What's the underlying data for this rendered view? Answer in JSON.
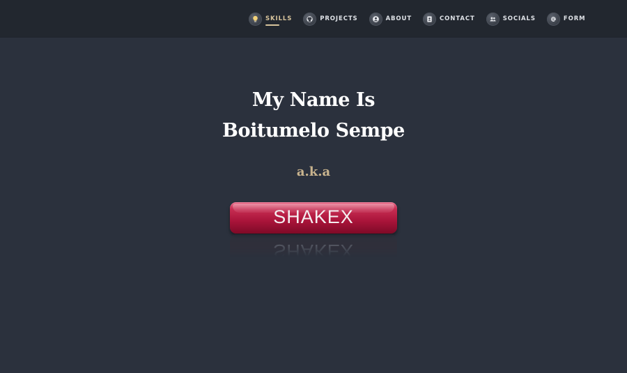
{
  "nav": {
    "items": [
      {
        "label": "SKILLS",
        "icon": "lightbulb-icon",
        "active": true
      },
      {
        "label": "PROJECTS",
        "icon": "github-icon",
        "active": false
      },
      {
        "label": "ABOUT",
        "icon": "user-circle-icon",
        "active": false
      },
      {
        "label": "CONTACT",
        "icon": "address-book-icon",
        "active": false
      },
      {
        "label": "SOCIALS",
        "icon": "users-icon",
        "active": false
      },
      {
        "label": "FORM",
        "icon": "at-sign-icon",
        "active": false
      }
    ]
  },
  "hero": {
    "line1": "My Name Is",
    "line2": "Boitumelo Sempe",
    "aka": "a.k.a"
  },
  "logo": {
    "text": "SHAKEX"
  },
  "colors": {
    "background": "#2b313d",
    "topbar": "#22272f",
    "accent": "#d8c49c",
    "aka": "#c9b48e",
    "logo_red": "#b3163f"
  }
}
